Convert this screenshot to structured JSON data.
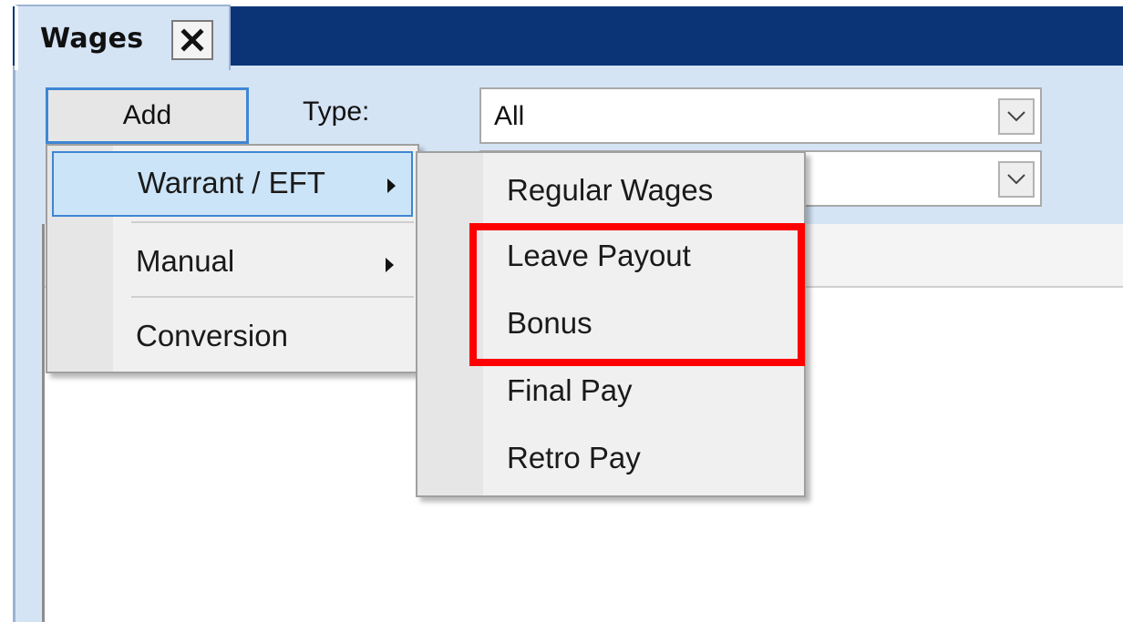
{
  "tab": {
    "title": "Wages",
    "close": "✕"
  },
  "toolbar": {
    "add_label": "Add",
    "type_label": "Type:"
  },
  "type_combo": {
    "value": "All"
  },
  "second_combo": {
    "value": ""
  },
  "add_menu": {
    "items": [
      {
        "label": "Warrant / EFT",
        "has_submenu": true,
        "highlighted": true
      },
      {
        "label": "Manual",
        "has_submenu": true
      },
      {
        "label": "Conversion",
        "has_submenu": false
      }
    ]
  },
  "warrant_submenu": {
    "items": [
      {
        "label": "Regular Wages"
      },
      {
        "label": "Leave Payout"
      },
      {
        "label": "Bonus"
      },
      {
        "label": "Final Pay"
      },
      {
        "label": "Retro Pay"
      }
    ]
  },
  "colors": {
    "title_bar": "#0a3475",
    "panel": "#d5e4f5",
    "highlight": "#cce4f7",
    "accent_border": "#3f86d4",
    "annotation": "#ff0000"
  }
}
